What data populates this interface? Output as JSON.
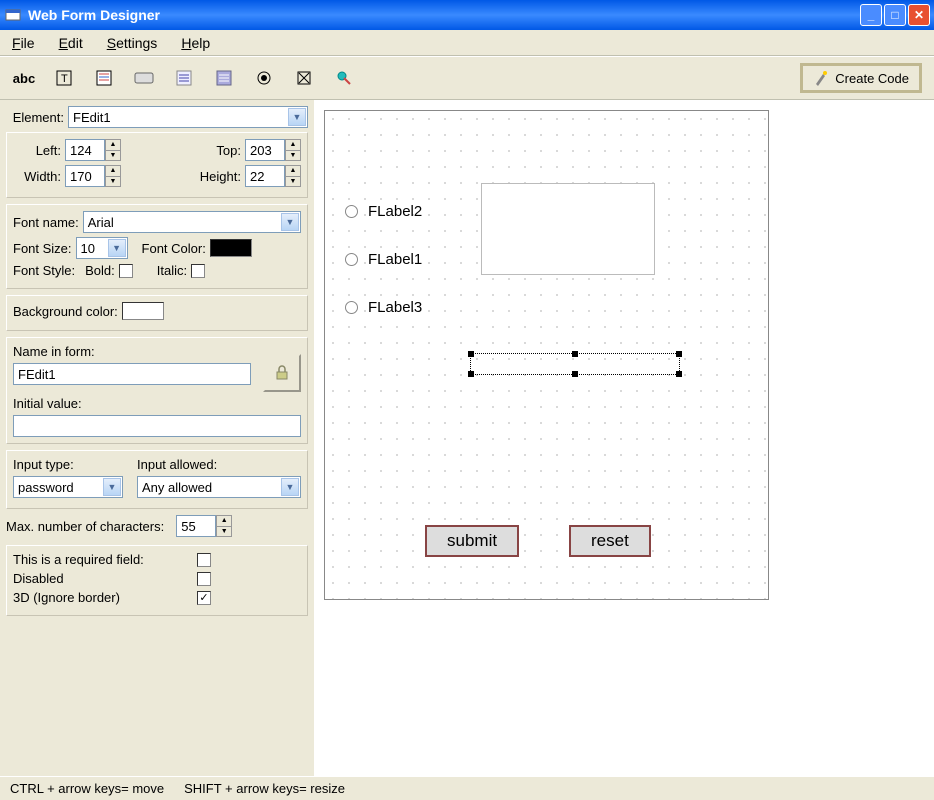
{
  "window": {
    "title": "Web Form Designer"
  },
  "menu": {
    "file": "File",
    "edit": "Edit",
    "settings": "Settings",
    "help": "Help"
  },
  "toolbar": {
    "abc": "abc",
    "create_code": "Create Code"
  },
  "props": {
    "element_label": "Element:",
    "element_value": "FEdit1",
    "left_label": "Left:",
    "left": "124",
    "top_label": "Top:",
    "top": "203",
    "width_label": "Width:",
    "width": "170",
    "height_label": "Height:",
    "height": "22",
    "font_name_label": "Font name:",
    "font_name": "Arial",
    "font_size_label": "Font Size:",
    "font_size": "10",
    "font_color_label": "Font Color:",
    "font_color": "#000000",
    "font_style_label": "Font Style:",
    "bold_label": "Bold:",
    "italic_label": "Italic:",
    "bg_color_label": "Background color:",
    "bg_color": "#ffffff",
    "name_label": "Name in form:",
    "name_value": "FEdit1",
    "initial_label": "Initial value:",
    "initial_value": "",
    "input_type_label": "Input type:",
    "input_type": "password",
    "input_allowed_label": "Input allowed:",
    "input_allowed": "Any allowed",
    "max_chars_label": "Max. number of characters:",
    "max_chars": "55",
    "required_label": "This is a required field:",
    "disabled_label": "Disabled",
    "ignore3d_label": "3D (Ignore border)",
    "ignore3d_checked": "✓"
  },
  "canvas": {
    "flabel2": "FLabel2",
    "flabel1": "FLabel1",
    "flabel3": "FLabel3",
    "submit": "submit",
    "reset": "reset"
  },
  "status": {
    "move": "CTRL + arrow keys= move",
    "resize": "SHIFT + arrow keys= resize"
  }
}
